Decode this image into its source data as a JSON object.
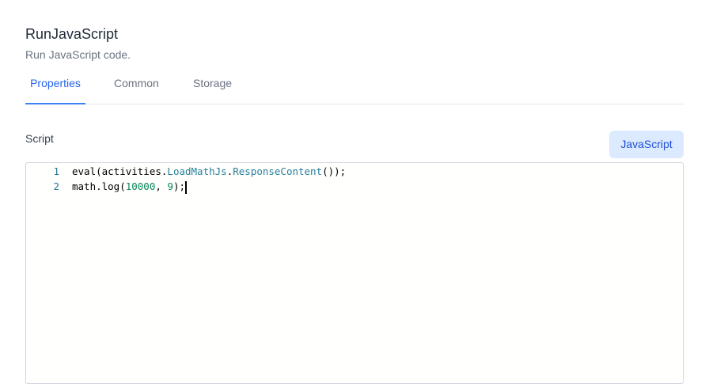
{
  "header": {
    "title": "RunJavaScript",
    "subtitle": "Run JavaScript code."
  },
  "tabs": [
    {
      "label": "Properties",
      "active": true
    },
    {
      "label": "Common",
      "active": false
    },
    {
      "label": "Storage",
      "active": false
    }
  ],
  "script": {
    "label": "Script",
    "language_button": "JavaScript",
    "lines": [
      {
        "number": "1",
        "tokens": [
          {
            "text": "eval(activities.",
            "kind": "ident"
          },
          {
            "text": "LoadMathJs",
            "kind": "member"
          },
          {
            "text": ".",
            "kind": "ident"
          },
          {
            "text": "ResponseContent",
            "kind": "member"
          },
          {
            "text": "());",
            "kind": "ident"
          }
        ]
      },
      {
        "number": "2",
        "tokens": [
          {
            "text": "math.log(",
            "kind": "ident"
          },
          {
            "text": "10000",
            "kind": "num"
          },
          {
            "text": ", ",
            "kind": "ident"
          },
          {
            "text": "9",
            "kind": "num"
          },
          {
            "text": ");",
            "kind": "ident"
          }
        ]
      }
    ]
  },
  "colors": {
    "accent": "#2563eb",
    "button_bg": "#dbeafe",
    "line_number": "#237893",
    "member_token": "#267f99",
    "number_token": "#098658"
  }
}
